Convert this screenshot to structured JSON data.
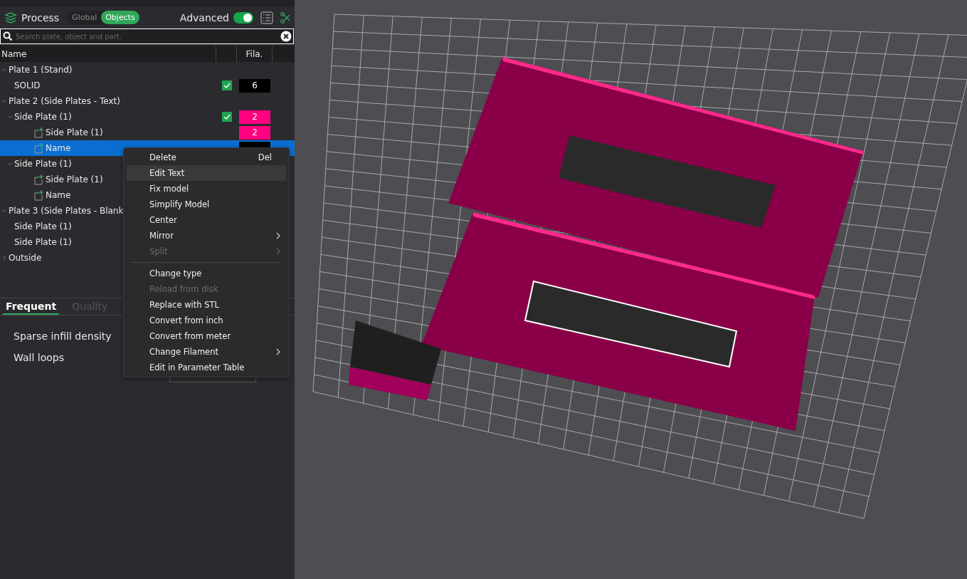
{
  "header": {
    "title": "Process",
    "modes": [
      {
        "label": "Global",
        "selected": false
      },
      {
        "label": "Objects",
        "selected": true
      }
    ],
    "advanced": {
      "label": "Advanced",
      "on": true
    }
  },
  "search": {
    "placeholder": "Search plate, object and part."
  },
  "columns": [
    "Name",
    "Fila."
  ],
  "tree": [
    {
      "kind": "plate",
      "name": "Plate 1 (Stand)",
      "expanded": true,
      "selected": false,
      "children": [
        {
          "kind": "object",
          "name": "SOLID",
          "checked": true,
          "filament": "6",
          "color": "#000000",
          "selected": false
        }
      ]
    },
    {
      "kind": "plate",
      "name": "Plate 2 (Side Plates - Text)",
      "expanded": true,
      "selected": false,
      "children": [
        {
          "kind": "object",
          "name": "Side Plate (1)",
          "expanded": true,
          "checked": true,
          "filament": "2",
          "color": "#ff0080",
          "selected": false,
          "children": [
            {
              "kind": "part",
              "name": "Side Plate (1)",
              "filament": "2",
              "color": "#ff0080",
              "selected": false
            },
            {
              "kind": "part",
              "name": "Name",
              "color": "#000000",
              "selected": true
            }
          ]
        },
        {
          "kind": "object",
          "name": "Side Plate (1)",
          "expanded": true,
          "selected": false,
          "children": [
            {
              "kind": "part",
              "name": "Side Plate (1)",
              "selected": false
            },
            {
              "kind": "part",
              "name": "Name",
              "selected": false
            }
          ]
        }
      ]
    },
    {
      "kind": "plate",
      "name": "Plate 3 (Side Plates - Blank",
      "expanded": true,
      "selected": false,
      "children": [
        {
          "kind": "object",
          "name": "Side Plate (1)",
          "selected": false
        },
        {
          "kind": "object",
          "name": "Side Plate (1)",
          "selected": false
        }
      ]
    },
    {
      "kind": "plate",
      "name": "Outside",
      "expanded": false,
      "selected": false
    }
  ],
  "settings_tabs": [
    {
      "label": "Frequent",
      "selected": true
    },
    {
      "label": "Quality",
      "selected": false
    }
  ],
  "settings": [
    {
      "label": "Sparse infill density"
    },
    {
      "label": "Wall loops"
    }
  ],
  "context_menu": [
    {
      "kind": "item",
      "label": "Delete",
      "shortcut": "Del",
      "disabled": false,
      "highlighted": false
    },
    {
      "kind": "item",
      "label": "Edit Text",
      "disabled": false,
      "highlighted": true
    },
    {
      "kind": "item",
      "label": "Fix model",
      "disabled": false,
      "highlighted": false
    },
    {
      "kind": "item",
      "label": "Simplify Model",
      "disabled": false,
      "highlighted": false
    },
    {
      "kind": "item",
      "label": "Center",
      "disabled": false,
      "highlighted": false
    },
    {
      "kind": "item",
      "label": "Mirror",
      "submenu": true,
      "disabled": false,
      "highlighted": false
    },
    {
      "kind": "item",
      "label": "Split",
      "submenu": true,
      "disabled": true,
      "highlighted": false
    },
    {
      "kind": "separator"
    },
    {
      "kind": "item",
      "label": "Change type",
      "disabled": false,
      "highlighted": false
    },
    {
      "kind": "item",
      "label": "Reload from disk",
      "disabled": true,
      "highlighted": false
    },
    {
      "kind": "item",
      "label": "Replace with STL",
      "disabled": false,
      "highlighted": false
    },
    {
      "kind": "item",
      "label": "Convert from inch",
      "disabled": false,
      "highlighted": false
    },
    {
      "kind": "item",
      "label": "Convert from meter",
      "disabled": false,
      "highlighted": false
    },
    {
      "kind": "item",
      "label": "Change Filament",
      "submenu": true,
      "disabled": false,
      "highlighted": false
    },
    {
      "kind": "item",
      "label": "Edit in Parameter Table",
      "disabled": false,
      "highlighted": false
    }
  ]
}
